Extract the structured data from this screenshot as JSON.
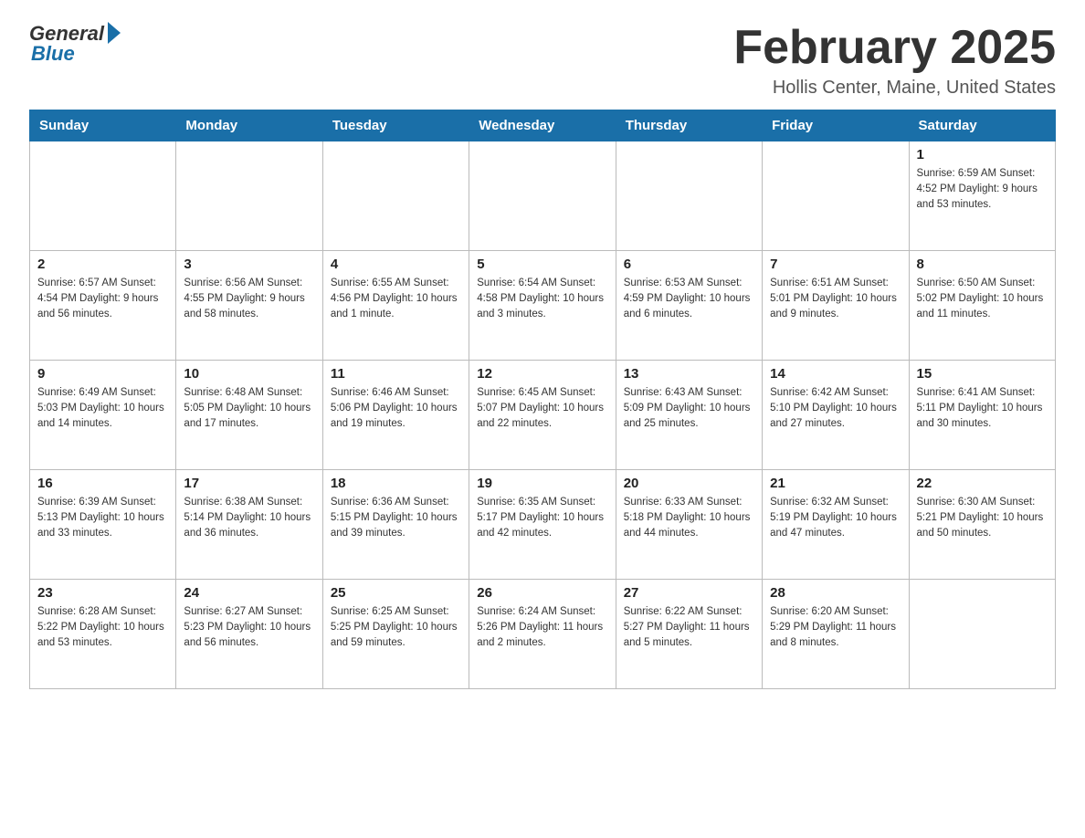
{
  "header": {
    "logo_general": "General",
    "logo_blue": "Blue",
    "month": "February 2025",
    "location": "Hollis Center, Maine, United States"
  },
  "weekdays": [
    "Sunday",
    "Monday",
    "Tuesday",
    "Wednesday",
    "Thursday",
    "Friday",
    "Saturday"
  ],
  "weeks": [
    [
      {
        "day": "",
        "info": ""
      },
      {
        "day": "",
        "info": ""
      },
      {
        "day": "",
        "info": ""
      },
      {
        "day": "",
        "info": ""
      },
      {
        "day": "",
        "info": ""
      },
      {
        "day": "",
        "info": ""
      },
      {
        "day": "1",
        "info": "Sunrise: 6:59 AM\nSunset: 4:52 PM\nDaylight: 9 hours\nand 53 minutes."
      }
    ],
    [
      {
        "day": "2",
        "info": "Sunrise: 6:57 AM\nSunset: 4:54 PM\nDaylight: 9 hours\nand 56 minutes."
      },
      {
        "day": "3",
        "info": "Sunrise: 6:56 AM\nSunset: 4:55 PM\nDaylight: 9 hours\nand 58 minutes."
      },
      {
        "day": "4",
        "info": "Sunrise: 6:55 AM\nSunset: 4:56 PM\nDaylight: 10 hours\nand 1 minute."
      },
      {
        "day": "5",
        "info": "Sunrise: 6:54 AM\nSunset: 4:58 PM\nDaylight: 10 hours\nand 3 minutes."
      },
      {
        "day": "6",
        "info": "Sunrise: 6:53 AM\nSunset: 4:59 PM\nDaylight: 10 hours\nand 6 minutes."
      },
      {
        "day": "7",
        "info": "Sunrise: 6:51 AM\nSunset: 5:01 PM\nDaylight: 10 hours\nand 9 minutes."
      },
      {
        "day": "8",
        "info": "Sunrise: 6:50 AM\nSunset: 5:02 PM\nDaylight: 10 hours\nand 11 minutes."
      }
    ],
    [
      {
        "day": "9",
        "info": "Sunrise: 6:49 AM\nSunset: 5:03 PM\nDaylight: 10 hours\nand 14 minutes."
      },
      {
        "day": "10",
        "info": "Sunrise: 6:48 AM\nSunset: 5:05 PM\nDaylight: 10 hours\nand 17 minutes."
      },
      {
        "day": "11",
        "info": "Sunrise: 6:46 AM\nSunset: 5:06 PM\nDaylight: 10 hours\nand 19 minutes."
      },
      {
        "day": "12",
        "info": "Sunrise: 6:45 AM\nSunset: 5:07 PM\nDaylight: 10 hours\nand 22 minutes."
      },
      {
        "day": "13",
        "info": "Sunrise: 6:43 AM\nSunset: 5:09 PM\nDaylight: 10 hours\nand 25 minutes."
      },
      {
        "day": "14",
        "info": "Sunrise: 6:42 AM\nSunset: 5:10 PM\nDaylight: 10 hours\nand 27 minutes."
      },
      {
        "day": "15",
        "info": "Sunrise: 6:41 AM\nSunset: 5:11 PM\nDaylight: 10 hours\nand 30 minutes."
      }
    ],
    [
      {
        "day": "16",
        "info": "Sunrise: 6:39 AM\nSunset: 5:13 PM\nDaylight: 10 hours\nand 33 minutes."
      },
      {
        "day": "17",
        "info": "Sunrise: 6:38 AM\nSunset: 5:14 PM\nDaylight: 10 hours\nand 36 minutes."
      },
      {
        "day": "18",
        "info": "Sunrise: 6:36 AM\nSunset: 5:15 PM\nDaylight: 10 hours\nand 39 minutes."
      },
      {
        "day": "19",
        "info": "Sunrise: 6:35 AM\nSunset: 5:17 PM\nDaylight: 10 hours\nand 42 minutes."
      },
      {
        "day": "20",
        "info": "Sunrise: 6:33 AM\nSunset: 5:18 PM\nDaylight: 10 hours\nand 44 minutes."
      },
      {
        "day": "21",
        "info": "Sunrise: 6:32 AM\nSunset: 5:19 PM\nDaylight: 10 hours\nand 47 minutes."
      },
      {
        "day": "22",
        "info": "Sunrise: 6:30 AM\nSunset: 5:21 PM\nDaylight: 10 hours\nand 50 minutes."
      }
    ],
    [
      {
        "day": "23",
        "info": "Sunrise: 6:28 AM\nSunset: 5:22 PM\nDaylight: 10 hours\nand 53 minutes."
      },
      {
        "day": "24",
        "info": "Sunrise: 6:27 AM\nSunset: 5:23 PM\nDaylight: 10 hours\nand 56 minutes."
      },
      {
        "day": "25",
        "info": "Sunrise: 6:25 AM\nSunset: 5:25 PM\nDaylight: 10 hours\nand 59 minutes."
      },
      {
        "day": "26",
        "info": "Sunrise: 6:24 AM\nSunset: 5:26 PM\nDaylight: 11 hours\nand 2 minutes."
      },
      {
        "day": "27",
        "info": "Sunrise: 6:22 AM\nSunset: 5:27 PM\nDaylight: 11 hours\nand 5 minutes."
      },
      {
        "day": "28",
        "info": "Sunrise: 6:20 AM\nSunset: 5:29 PM\nDaylight: 11 hours\nand 8 minutes."
      },
      {
        "day": "",
        "info": ""
      }
    ]
  ]
}
